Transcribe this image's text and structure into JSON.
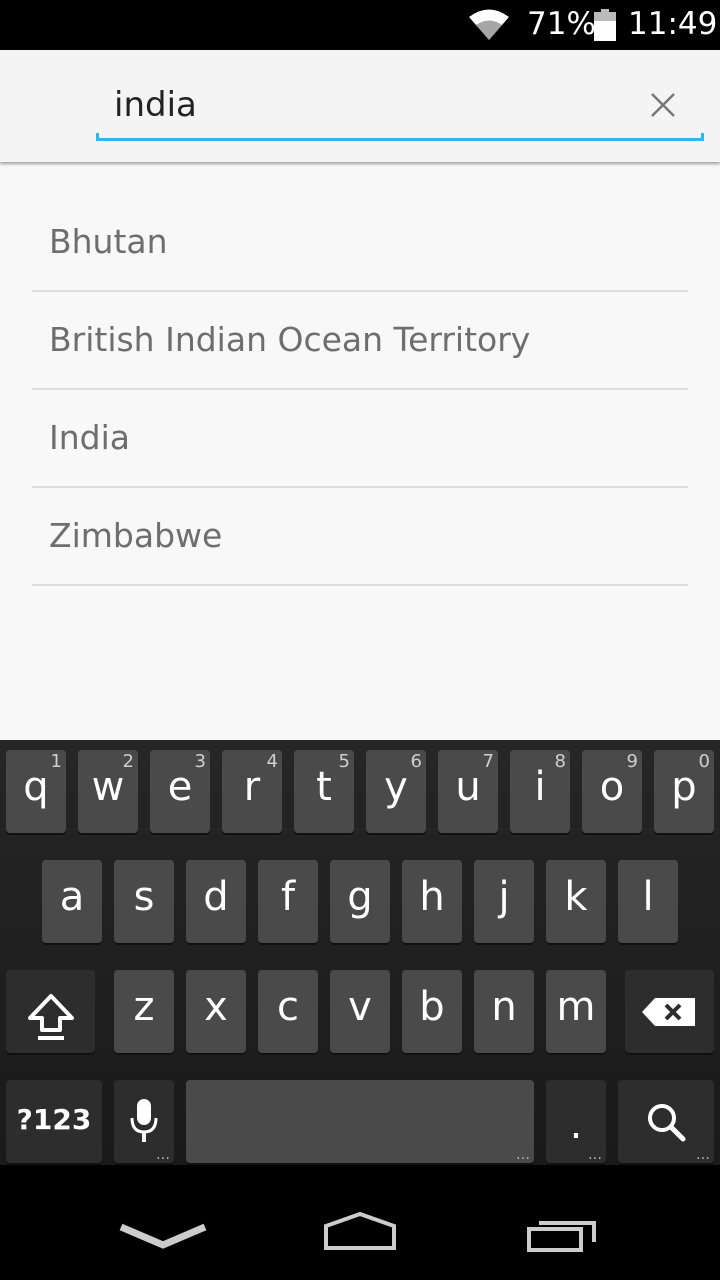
{
  "status_bar": {
    "battery_percent": "71%",
    "time": "11:49",
    "icons": [
      "wifi-icon",
      "battery-icon"
    ]
  },
  "search": {
    "value": "india",
    "placeholder": "",
    "accent_color": "#33b5e5",
    "clear_icon": "close-icon"
  },
  "results": [
    {
      "label": "Bhutan"
    },
    {
      "label": "British Indian Ocean Territory"
    },
    {
      "label": "India"
    },
    {
      "label": "Zimbabwe"
    }
  ],
  "keyboard": {
    "row1": [
      {
        "key": "q",
        "hint": "1"
      },
      {
        "key": "w",
        "hint": "2"
      },
      {
        "key": "e",
        "hint": "3"
      },
      {
        "key": "r",
        "hint": "4"
      },
      {
        "key": "t",
        "hint": "5"
      },
      {
        "key": "y",
        "hint": "6"
      },
      {
        "key": "u",
        "hint": "7"
      },
      {
        "key": "i",
        "hint": "8"
      },
      {
        "key": "o",
        "hint": "9"
      },
      {
        "key": "p",
        "hint": "0"
      }
    ],
    "row2": [
      "a",
      "s",
      "d",
      "f",
      "g",
      "h",
      "j",
      "k",
      "l"
    ],
    "row3": [
      "z",
      "x",
      "c",
      "v",
      "b",
      "n",
      "m"
    ],
    "symbols_label": "?123",
    "period_label": ".",
    "function_icons": [
      "shift-icon",
      "backspace-icon",
      "microphone-icon",
      "search-icon"
    ]
  },
  "nav_bar": {
    "icons": [
      "back-icon",
      "home-icon",
      "recent-apps-icon"
    ]
  }
}
